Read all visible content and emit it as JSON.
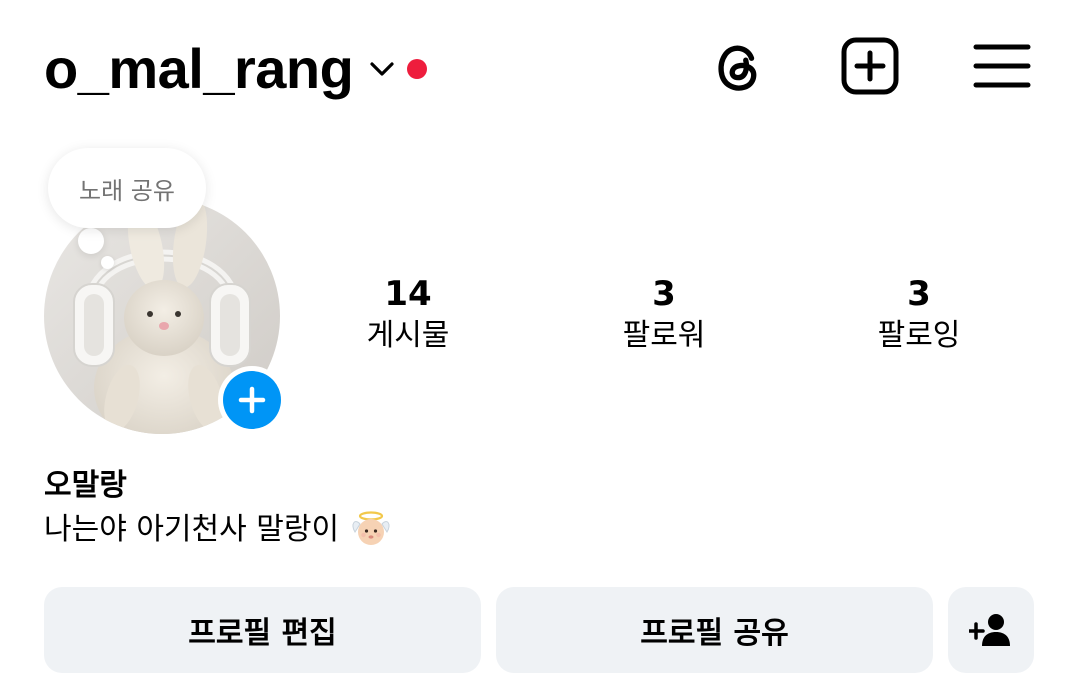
{
  "header": {
    "username": "o_mal_rang",
    "notification_dot_color": "#ee1d3d",
    "icons": [
      "chevron-down-icon",
      "threads-icon",
      "create-icon",
      "menu-icon"
    ]
  },
  "note": {
    "text": "노래 공유"
  },
  "profile": {
    "accent_color": "#0095f6",
    "stats": {
      "posts": {
        "count": "14",
        "label": "게시물"
      },
      "followers": {
        "count": "3",
        "label": "팔로워"
      },
      "following": {
        "count": "3",
        "label": "팔로잉"
      }
    },
    "display_name": "오말랑",
    "bio": "나는야 아기천사 말랑이",
    "bio_emoji": "baby-angel-emoji"
  },
  "actions": {
    "edit_label": "프로필 편집",
    "share_label": "프로필 공유",
    "discover_icon": "add-person-icon",
    "button_bg": "#eff2f5"
  }
}
